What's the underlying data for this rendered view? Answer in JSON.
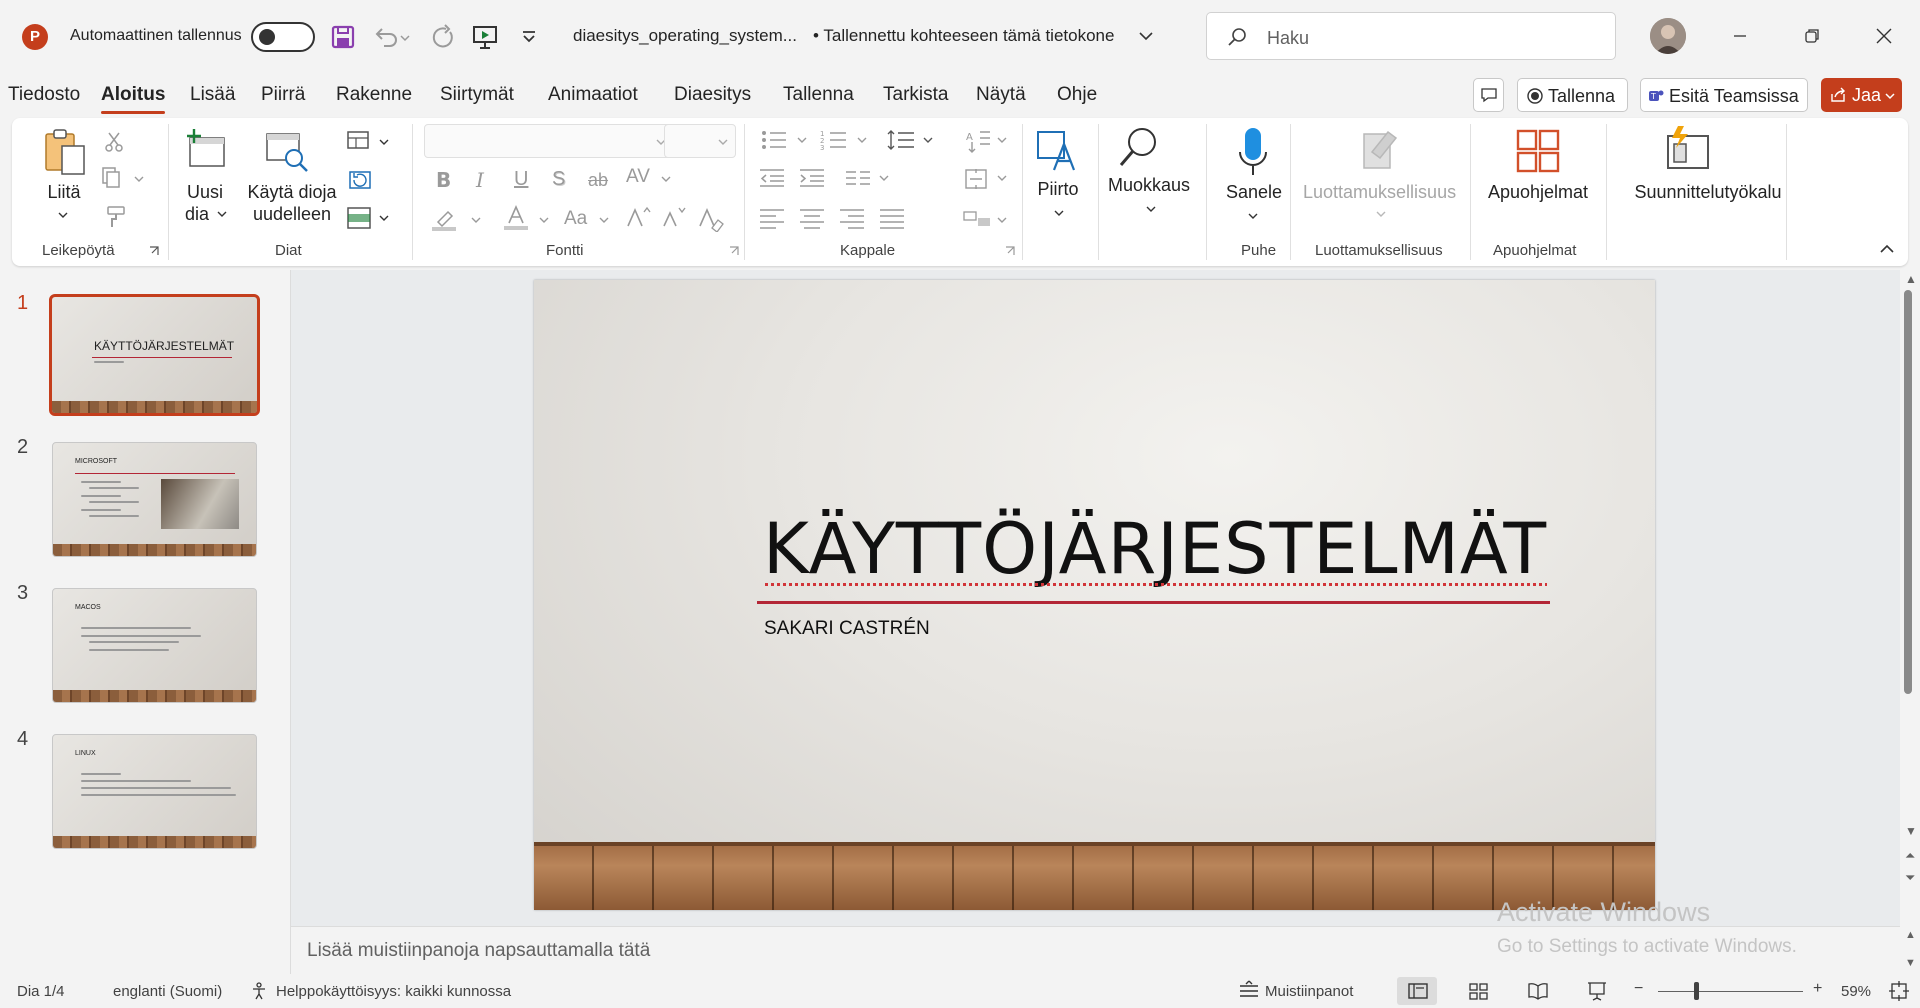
{
  "app": {
    "logo": "P"
  },
  "titlebar": {
    "autosave_label": "Automaattinen tallennus",
    "doc_title": "diaesitys_operating_system...",
    "saved_status": "• Tallennettu kohteeseen tämä tietokone",
    "search_placeholder": "Haku"
  },
  "tabs": [
    "Tiedosto",
    "Aloitus",
    "Lisää",
    "Piirrä",
    "Rakenne",
    "Siirtymät",
    "Animaatiot",
    "Diaesitys",
    "Tallenna",
    "Tarkista",
    "Näytä",
    "Ohje"
  ],
  "active_tab": "Aloitus",
  "tab_actions": {
    "record": "Tallenna",
    "teams": "Esitä Teamsissa",
    "share": "Jaa"
  },
  "ribbon": {
    "paste": "Liitä",
    "new_slide_1": "Uusi",
    "new_slide_2": "dia",
    "reuse_1": "Käytä dioja",
    "reuse_2": "uudelleen",
    "drawing": "Piirto",
    "editing": "Muokkaus",
    "dictate": "Sanele",
    "sensitivity": "Luottamuksellisuus",
    "addins": "Apuohjelmat",
    "designer": "Suunnittelutyökalu",
    "groups": {
      "clipboard": "Leikepöytä",
      "slides": "Diat",
      "font": "Fontti",
      "paragraph": "Kappale",
      "voice": "Puhe",
      "sensitivity": "Luottamuksellisuus",
      "addins": "Apuohjelmat"
    },
    "font_buttons": {
      "bold": "B",
      "italic": "I",
      "underline": "U",
      "shadow": "S",
      "strike": "ab",
      "spacing": "AV",
      "case": "Aa"
    }
  },
  "slides": [
    {
      "num": "1",
      "title": "KÄYTTÖJÄRJESTELMÄT"
    },
    {
      "num": "2",
      "title": "MICROSOFT"
    },
    {
      "num": "3",
      "title": "MACOS"
    },
    {
      "num": "4",
      "title": "LINUX"
    }
  ],
  "current_slide": {
    "title": "KÄYTTÖJÄRJESTELMÄT",
    "subtitle": "SAKARI CASTRÉN",
    "accent_color": "#b32636"
  },
  "notes_placeholder": "Lisää muistiinpanoja napsauttamalla tätä",
  "watermark": {
    "line1": "Activate Windows",
    "line2": "Go to Settings to activate Windows."
  },
  "status": {
    "slide_indicator": "Dia 1/4",
    "language": "englanti (Suomi)",
    "accessibility": "Helppokäyttöisyys: kaikki kunnossa",
    "notes": "Muistiinpanot",
    "zoom": "59%"
  },
  "colors": {
    "accent": "#c43e1c"
  }
}
